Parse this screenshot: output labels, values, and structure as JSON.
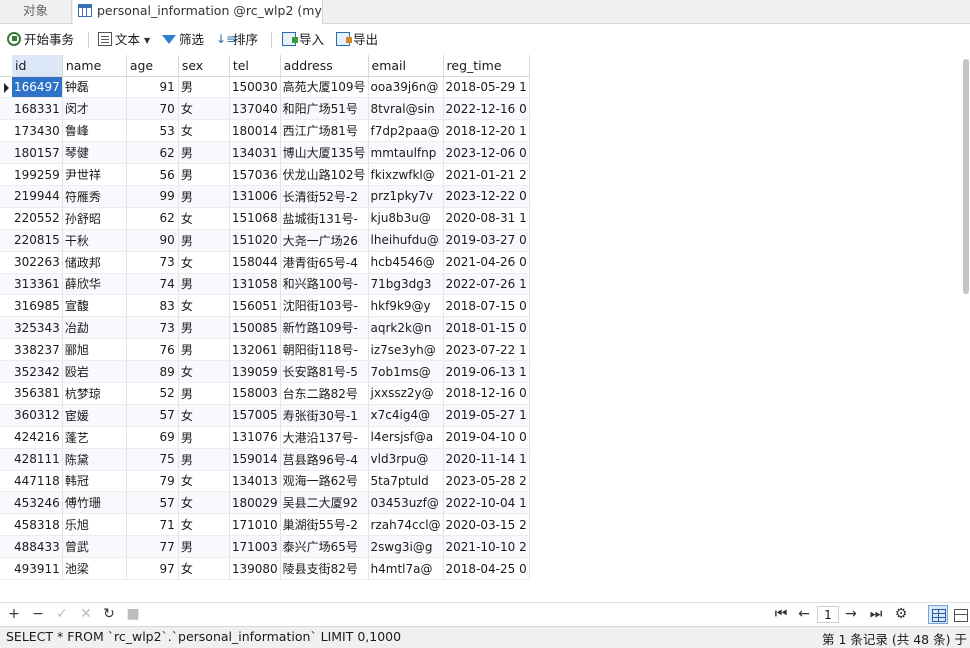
{
  "tabs": {
    "objects": "对象",
    "active": "personal_information @rc_wlp2 (mys..."
  },
  "toolbar": {
    "begin_tx": "开始事务",
    "text": "文本",
    "filter": "筛选",
    "sort": "排序",
    "import": "导入",
    "export": "导出"
  },
  "columns": [
    "id",
    "name",
    "age",
    "sex",
    "tel",
    "address",
    "email",
    "reg_time"
  ],
  "rows": [
    [
      "166497",
      "钟磊",
      "91",
      "男",
      "150030",
      "高苑大厦109号",
      "ooa39j6n@",
      "2018-05-29 1"
    ],
    [
      "168331",
      "闵才",
      "70",
      "女",
      "137040",
      "和阳广场51号",
      "8tvral@sin",
      "2022-12-16 0"
    ],
    [
      "173430",
      "鲁峰",
      "53",
      "女",
      "180014",
      "西江广场81号",
      "f7dp2paa@",
      "2018-12-20 1"
    ],
    [
      "180157",
      "琴健",
      "62",
      "男",
      "134031",
      "博山大厦135号",
      "mmtaulfnp",
      "2023-12-06 0"
    ],
    [
      "199259",
      "尹世祥",
      "56",
      "男",
      "157036",
      "伏龙山路102号",
      "fkixzwfkl@",
      "2021-01-21 2"
    ],
    [
      "219944",
      "符雁秀",
      "99",
      "男",
      "131006",
      "长清街52号-2",
      "prz1pky7v",
      "2023-12-22 0"
    ],
    [
      "220552",
      "孙舒昭",
      "62",
      "女",
      "151068",
      "盐城街131号-",
      "kju8b3u@",
      "2020-08-31 1"
    ],
    [
      "220815",
      "干秋",
      "90",
      "男",
      "151020",
      "大尧一广场26",
      "lheihufdu@",
      "2019-03-27 0"
    ],
    [
      "302263",
      "储政邦",
      "73",
      "女",
      "158044",
      "港青街65号-4",
      "hcb4546@",
      "2021-04-26 0"
    ],
    [
      "313361",
      "薛欣华",
      "74",
      "男",
      "131058",
      "和兴路100号-",
      "71bg3dg3",
      "2022-07-26 1"
    ],
    [
      "316985",
      "宣馥",
      "83",
      "女",
      "156051",
      "沈阳街103号-",
      "hkf9k9@y",
      "2018-07-15 0"
    ],
    [
      "325343",
      "冶勐",
      "73",
      "男",
      "150085",
      "新竹路109号-",
      "aqrk2k@n",
      "2018-01-15 0"
    ],
    [
      "338237",
      "郦旭",
      "76",
      "男",
      "132061",
      "朝阳街118号-",
      "iz7se3yh@",
      "2023-07-22 1"
    ],
    [
      "352342",
      "殴岩",
      "89",
      "女",
      "139059",
      "长安路81号-5",
      "7ob1ms@",
      "2019-06-13 1"
    ],
    [
      "356381",
      "杭梦琼",
      "52",
      "男",
      "158003",
      "台东二路82号",
      "jxxssz2y@",
      "2018-12-16 0"
    ],
    [
      "360312",
      "宦媛",
      "57",
      "女",
      "157005",
      "寿张街30号-1",
      "x7c4ig4@",
      "2019-05-27 1"
    ],
    [
      "424216",
      "蓬艺",
      "69",
      "男",
      "131076",
      "大港沿137号-",
      "l4ersjsf@a",
      "2019-04-10 0"
    ],
    [
      "428111",
      "陈黛",
      "75",
      "男",
      "159014",
      "莒县路96号-4",
      "vld3rpu@",
      "2020-11-14 1"
    ],
    [
      "447118",
      "韩冠",
      "79",
      "女",
      "134013",
      "观海一路62号",
      "5ta7ptuld",
      "2023-05-28 2"
    ],
    [
      "453246",
      "傅竹珊",
      "57",
      "女",
      "180029",
      "吴县二大厦92",
      "03453uzf@",
      "2022-10-04 1"
    ],
    [
      "458318",
      "乐旭",
      "71",
      "女",
      "171010",
      "巢湖街55号-2",
      "rzah74ccl@",
      "2020-03-15 2"
    ],
    [
      "488433",
      "曾武",
      "77",
      "男",
      "171003",
      "泰兴广场65号",
      "2swg3i@g",
      "2021-10-10 2"
    ],
    [
      "493911",
      "池梁",
      "97",
      "女",
      "139080",
      "陵县支街82号",
      "h4mtl7a@",
      "2018-04-25 0"
    ]
  ],
  "pager": {
    "page": "1"
  },
  "status": {
    "sql": "SELECT * FROM `rc_wlp2`.`personal_information` LIMIT 0,1000",
    "records": "第 1 条记录 (共 48 条) 于"
  },
  "icons": {
    "add": "plus-icon",
    "remove": "minus-icon",
    "apply": "check-icon",
    "discard": "x-icon",
    "refresh": "refresh-icon",
    "stop": "stop-icon",
    "first": "first-page-icon",
    "prev": "prev-page-icon",
    "next": "next-page-icon",
    "last": "last-page-icon",
    "settings": "gear-icon"
  },
  "colors": {
    "selection": "#2f73c9",
    "header_selected": "#dce8f7",
    "accent": "#2a6db5"
  }
}
